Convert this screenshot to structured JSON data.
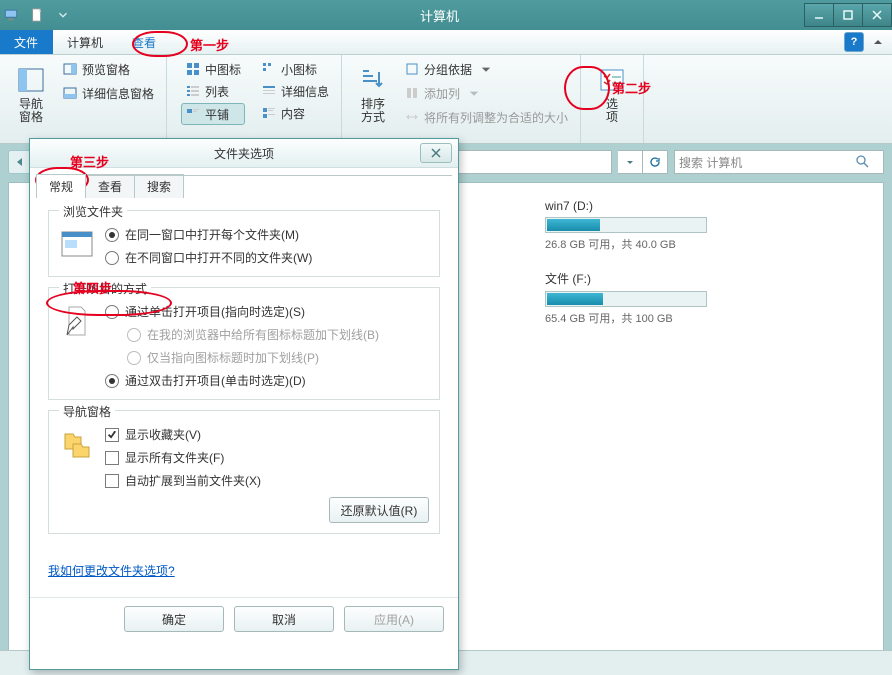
{
  "window": {
    "title": "计算机"
  },
  "menubar": {
    "file": "文件",
    "computer": "计算机",
    "view": "查看"
  },
  "ribbon": {
    "nav": "导航\n窗格",
    "preview": "预览窗格",
    "details": "详细信息窗格",
    "icon_m": "中图标",
    "icon_s": "小图标",
    "list": "列表",
    "detailv": "详细信息",
    "tiles": "平铺",
    "content": "内容",
    "sort": "排序\n方式",
    "group": "分组依据",
    "addcols": "添加列",
    "fit": "将所有列调整为合适的大小",
    "options": "选\n项"
  },
  "annotations": {
    "s1": "第一步",
    "s2": "第二步",
    "s3": "第三步",
    "s4": "第四步"
  },
  "search": {
    "placeholder": "搜索 计算机"
  },
  "drives": [
    {
      "name": "win7 (D:)",
      "free": "26.8 GB 可用，共 40.0 GB",
      "pct": 33
    },
    {
      "name": "文件 (F:)",
      "free": "65.4 GB 可用，共 100 GB",
      "pct": 35
    }
  ],
  "dialog": {
    "title": "文件夹选项",
    "tabs": {
      "general": "常规",
      "view": "查看",
      "search": "搜索"
    },
    "browse": {
      "legend": "浏览文件夹",
      "same": "在同一窗口中打开每个文件夹(M)",
      "diff": "在不同窗口中打开不同的文件夹(W)"
    },
    "open": {
      "legend": "打开项目的方式",
      "single": "通过单击打开项目(指向时选定)(S)",
      "ul_all": "在我的浏览器中给所有图标标题加下划线(B)",
      "ul_point": "仅当指向图标标题时加下划线(P)",
      "double": "通过双击打开项目(单击时选定)(D)"
    },
    "navpane": {
      "legend": "导航窗格",
      "fav": "显示收藏夹(V)",
      "all": "显示所有文件夹(F)",
      "expand": "自动扩展到当前文件夹(X)"
    },
    "restore": "还原默认值(R)",
    "link": "我如何更改文件夹选项?",
    "ok": "确定",
    "cancel": "取消",
    "apply": "应用(A)"
  }
}
